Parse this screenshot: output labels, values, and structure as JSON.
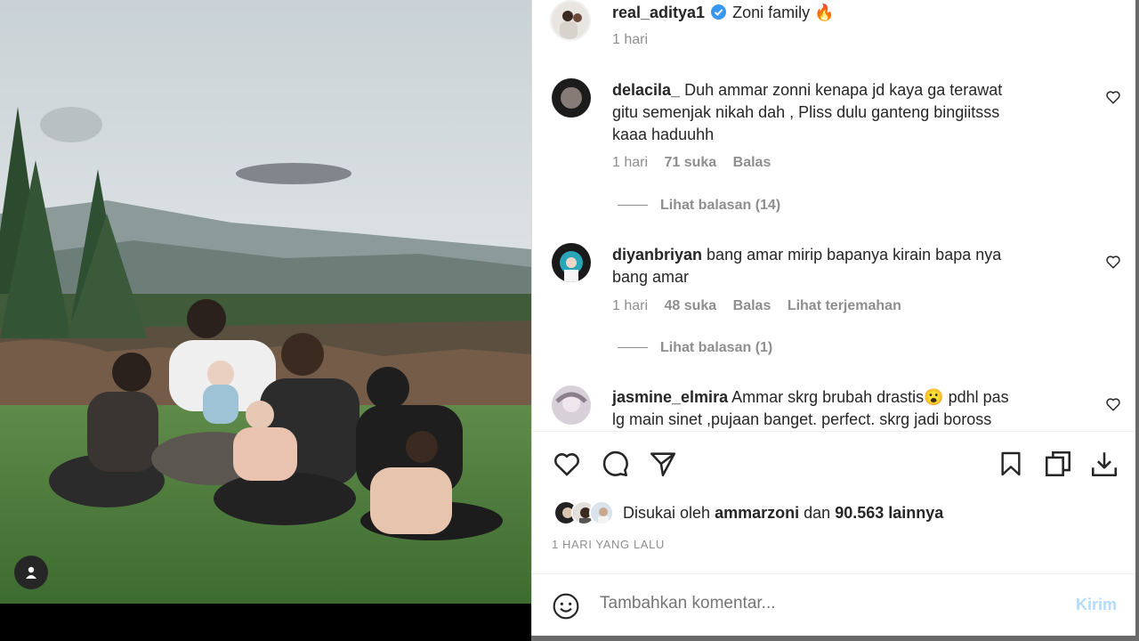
{
  "post": {
    "author": "real_aditya1",
    "caption": "Zoni family",
    "caption_emoji": "🔥",
    "time": "1 hari"
  },
  "comments": [
    {
      "user": "delacila_",
      "text": "Duh ammar zonni kenapa jd kaya ga terawat gitu semenjak nikah dah , Pliss dulu ganteng bingiitsss kaaa haduuhh",
      "time": "1 hari",
      "likes": "71 suka",
      "reply": "Balas",
      "view_replies": "Lihat balasan (14)"
    },
    {
      "user": "diyanbriyan",
      "text": "bang amar mirip bapanya kirain bapa nya bang amar",
      "time": "1 hari",
      "likes": "48 suka",
      "reply": "Balas",
      "translate": "Lihat terjemahan",
      "view_replies": "Lihat balasan (1)"
    },
    {
      "user": "jasmine_elmira",
      "text": "Ammar skrg brubah drastis😮 pdhl pas lg main sinet ,pujaan banget. perfect. skrg jadi boross bgt"
    }
  ],
  "likes": {
    "prefix": "Disukai oleh",
    "user": "ammarzoni",
    "conj": "dan",
    "count": "90.563 lainnya"
  },
  "posted_ago": "1 HARI YANG LALU",
  "comment_box": {
    "placeholder": "Tambahkan komentar...",
    "send": "Kirim"
  },
  "icons": [
    "like-icon",
    "comment-icon",
    "share-icon",
    "save-icon",
    "copy-icon",
    "download-icon",
    "emoji-icon",
    "verified-icon",
    "tag-user-icon"
  ],
  "colors": {
    "verified": "#3897f0",
    "send_disabled": "#b3dbff",
    "muted": "#8e8e8e",
    "text": "#262626"
  }
}
